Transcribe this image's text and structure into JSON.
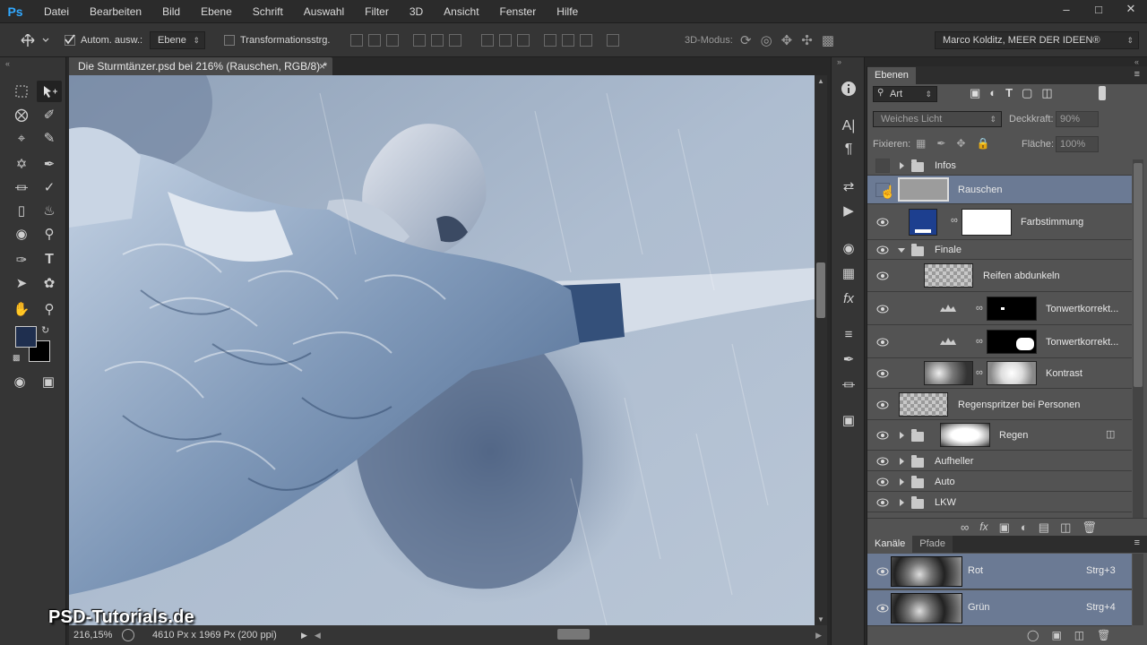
{
  "menubar": {
    "logo": "Ps",
    "items": [
      "Datei",
      "Bearbeiten",
      "Bild",
      "Ebene",
      "Schrift",
      "Auswahl",
      "Filter",
      "3D",
      "Ansicht",
      "Fenster",
      "Hilfe"
    ]
  },
  "options": {
    "auto_select_label": "Autom. ausw.:",
    "auto_select_target": "Ebene",
    "transform_label": "Transformationsstrg.",
    "mode_3d_label": "3D-Modus:",
    "workspace": "Marco Kolditz, MEER DER IDEEN®"
  },
  "document": {
    "tab_title": "Die Sturmtänzer.psd bei 216% (Rauschen, RGB/8) *",
    "zoom": "216,15%",
    "doc_info": "4610 Px x 1969 Px (200 ppi)"
  },
  "watermark": "PSD-Tutorials.de",
  "layers_panel": {
    "tab_label": "Ebenen",
    "filter_kind": "Art",
    "blend_mode": "Weiches Licht",
    "opacity_label": "Deckkraft:",
    "opacity_value": "90%",
    "lock_label": "Fixieren:",
    "fill_label": "Fläche:",
    "fill_value": "100%",
    "layers": [
      {
        "name": "Infos"
      },
      {
        "name": "Rauschen"
      },
      {
        "name": "Farbstimmung"
      },
      {
        "name": "Finale"
      },
      {
        "name": "Reifen abdunkeln"
      },
      {
        "name": "Tonwertkorrekt..."
      },
      {
        "name": "Tonwertkorrekt..."
      },
      {
        "name": "Kontrast"
      },
      {
        "name": "Regenspritzer bei Personen"
      },
      {
        "name": "Regen"
      },
      {
        "name": "Aufheller"
      },
      {
        "name": "Auto"
      },
      {
        "name": "LKW"
      }
    ]
  },
  "channels_panel": {
    "tabs": [
      "Kanäle",
      "Pfade"
    ],
    "channels": [
      {
        "name": "Rot",
        "shortcut": "Strg+3"
      },
      {
        "name": "Grün",
        "shortcut": "Strg+4"
      }
    ]
  },
  "colors": {
    "foreground": "#1f2f4f",
    "background": "#000000",
    "selection": "#6b7a94",
    "farbstimmung_swatch": "#1d3f8f"
  }
}
